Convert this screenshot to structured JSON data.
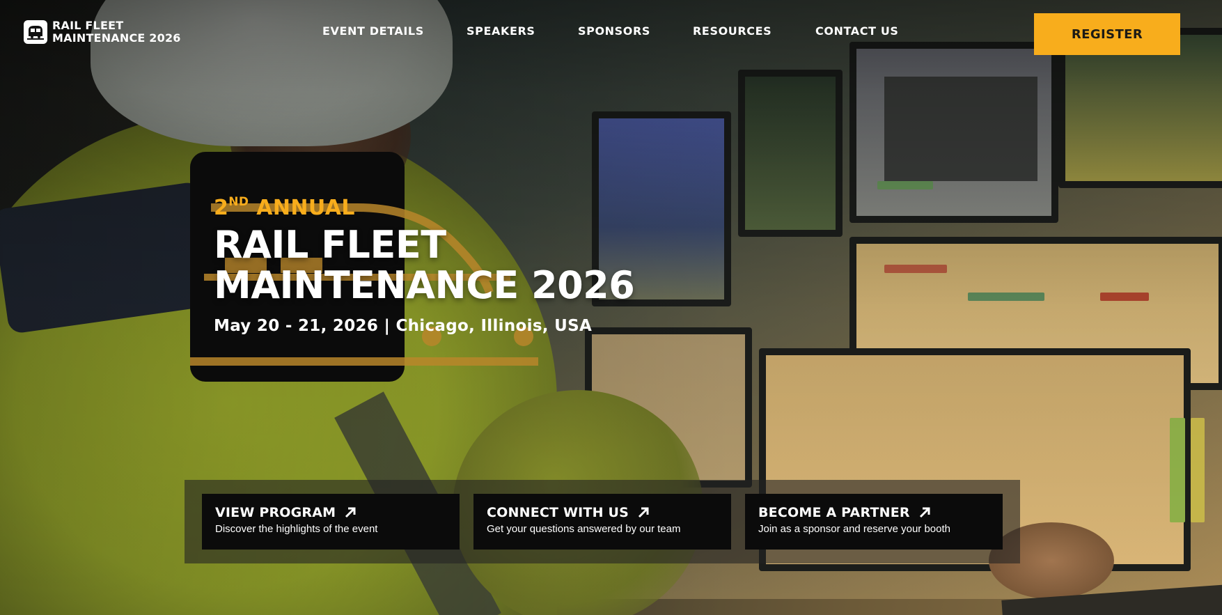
{
  "site": {
    "logo_line1": "RAIL FLEET",
    "logo_line2": "MAINTENANCE 2026"
  },
  "nav": {
    "links": [
      "EVENT DETAILS",
      "SPEAKERS",
      "SPONSORS",
      "RESOURCES",
      "CONTACT US"
    ],
    "register_label": "REGISTER"
  },
  "hero": {
    "ordinal": "2",
    "ordinal_suffix": "ND",
    "annual": "ANNUAL",
    "title_line1": "RAIL FLEET",
    "title_line2": "MAINTENANCE 2026",
    "subtitle": "May 20 - 21, 2026 | Chicago, Illinois, USA"
  },
  "cta": [
    {
      "title": "VIEW PROGRAM",
      "desc": "Discover the highlights of the event",
      "icon": "arrow-up-right-icon"
    },
    {
      "title": "CONNECT WITH US",
      "desc": "Get your questions answered by our team",
      "icon": "arrow-up-right-icon"
    },
    {
      "title": "BECOME A PARTNER",
      "desc": "Join as a sponsor and reserve your booth",
      "icon": "arrow-up-right-icon"
    }
  ],
  "colors": {
    "accent": "#f8ad1c",
    "card_bg": "#0b0b0b",
    "text": "#ffffff"
  }
}
